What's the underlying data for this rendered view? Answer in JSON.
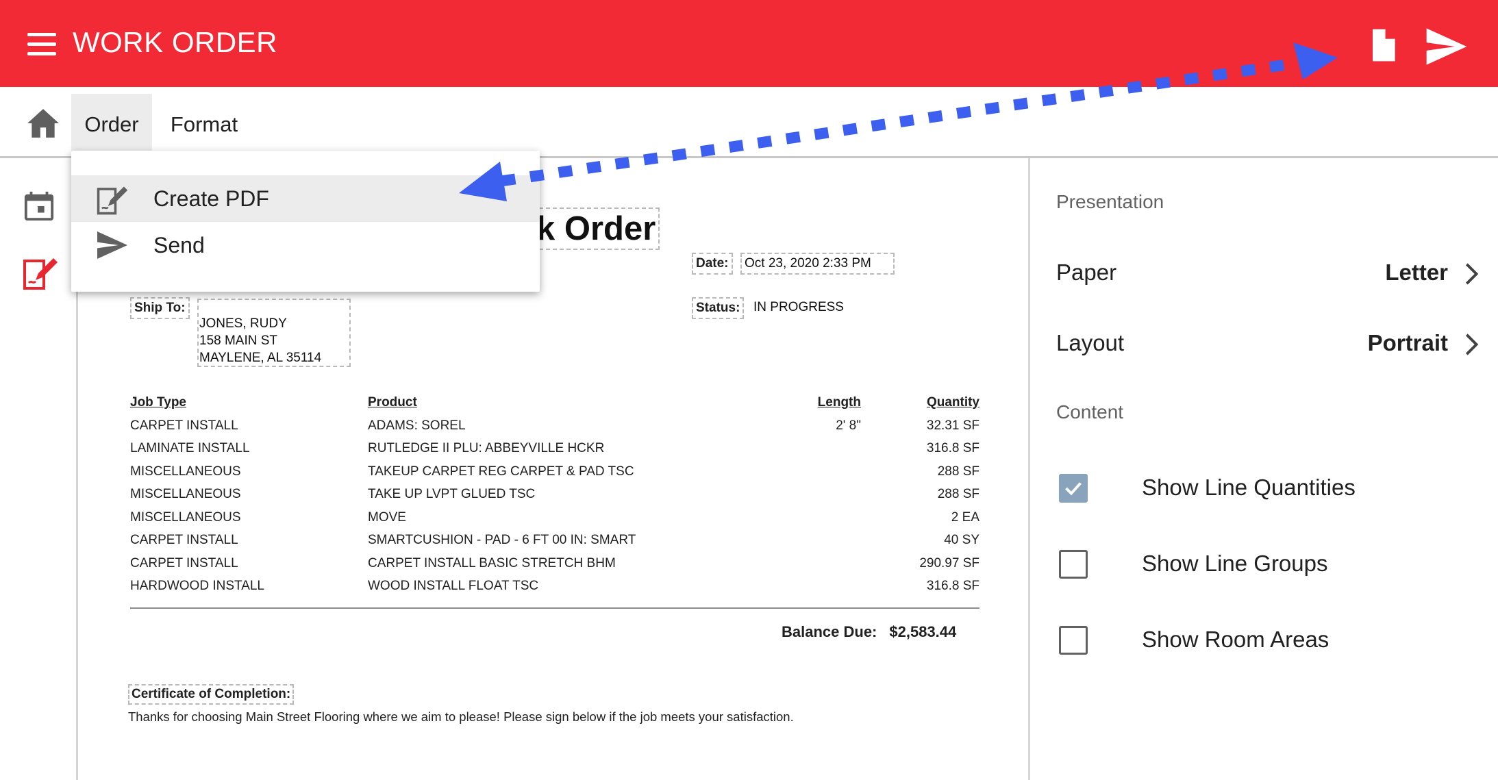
{
  "app": {
    "title": "WORK ORDER"
  },
  "menubar": {
    "order_label": "Order",
    "format_label": "Format"
  },
  "dropdown": {
    "items": [
      {
        "label": "Create PDF",
        "icon": "pdf-edit-icon"
      },
      {
        "label": "Send",
        "icon": "send-icon"
      }
    ]
  },
  "document": {
    "title": "k Order",
    "date_label": "Date:",
    "date_value": "Oct 23, 2020 2:33 PM",
    "status_label": "Status:",
    "status_value": "IN PROGRESS",
    "ship_to_label": "Ship To:",
    "ship_to": [
      "JONES, RUDY",
      "158 MAIN ST",
      "MAYLENE, AL 35114"
    ],
    "columns": {
      "job_type": "Job Type",
      "product": "Product",
      "length": "Length",
      "quantity": "Quantity"
    },
    "lines": [
      {
        "job_type": "CARPET INSTALL",
        "product": "ADAMS: SOREL",
        "length": "2' 8\"",
        "quantity": "32.31 SF"
      },
      {
        "job_type": "LAMINATE INSTALL",
        "product": "RUTLEDGE II PLU: ABBEYVILLE HCKR",
        "length": "",
        "quantity": "316.8 SF"
      },
      {
        "job_type": "MISCELLANEOUS",
        "product": "TAKEUP CARPET REG CARPET & PAD TSC",
        "length": "",
        "quantity": "288 SF"
      },
      {
        "job_type": "MISCELLANEOUS",
        "product": "TAKE UP LVPT GLUED TSC",
        "length": "",
        "quantity": "288 SF"
      },
      {
        "job_type": "MISCELLANEOUS",
        "product": "MOVE",
        "length": "",
        "quantity": "2 EA"
      },
      {
        "job_type": "CARPET INSTALL",
        "product": "SMARTCUSHION - PAD - 6 FT 00 IN: SMART",
        "length": "",
        "quantity": "40 SY"
      },
      {
        "job_type": "CARPET INSTALL",
        "product": "CARPET INSTALL BASIC STRETCH BHM",
        "length": "",
        "quantity": "290.97 SF"
      },
      {
        "job_type": "HARDWOOD INSTALL",
        "product": "WOOD INSTALL FLOAT TSC",
        "length": "",
        "quantity": "316.8 SF"
      }
    ],
    "balance_label": "Balance Due:",
    "balance_value": "$2,583.44",
    "certificate_label": "Certificate of Completion:",
    "certificate_text": "Thanks for choosing Main Street Flooring where we aim to please! Please sign below if the job meets your satisfaction."
  },
  "panel": {
    "presentation_heading": "Presentation",
    "paper_label": "Paper",
    "paper_value": "Letter",
    "layout_label": "Layout",
    "layout_value": "Portrait",
    "content_heading": "Content",
    "options": [
      {
        "label": "Show Line Quantities",
        "checked": true
      },
      {
        "label": "Show Line Groups",
        "checked": false
      },
      {
        "label": "Show Room Areas",
        "checked": false
      }
    ]
  },
  "colors": {
    "appbar": "#f22a36",
    "accent_icon": "#e8262f",
    "arrow": "#3d5ff0",
    "checkbox_checked": "#8aa3bd"
  }
}
